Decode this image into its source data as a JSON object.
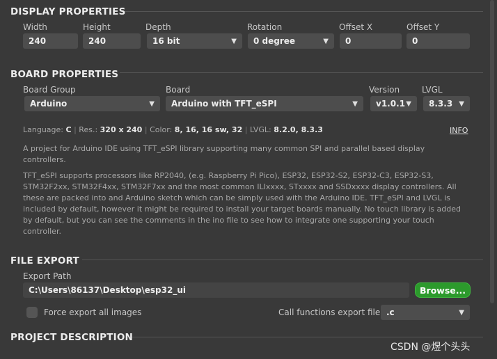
{
  "display": {
    "title": "DISPLAY PROPERTIES",
    "width_label": "Width",
    "width_value": "240",
    "height_label": "Height",
    "height_value": "240",
    "depth_label": "Depth",
    "depth_value": "16 bit",
    "rotation_label": "Rotation",
    "rotation_value": "0 degree",
    "offset_x_label": "Offset X",
    "offset_x_value": "0",
    "offset_y_label": "Offset Y",
    "offset_y_value": "0"
  },
  "board": {
    "title": "BOARD PROPERTIES",
    "group_label": "Board Group",
    "group_value": "Arduino",
    "board_label": "Board",
    "board_value": "Arduino with TFT_eSPI",
    "version_label": "Version",
    "version_value": "v1.0.1",
    "lvgl_label": "LVGL",
    "lvgl_value": "8.3.3",
    "meta": {
      "language_label": "Language:",
      "language_value": "C",
      "res_label": "Res.:",
      "res_value": "320 x 240",
      "color_label": "Color:",
      "color_value": "8, 16, 16 sw, 32",
      "lvgl_label": "LVGL:",
      "lvgl_value": "8.2.0, 8.3.3"
    },
    "info_link": "INFO",
    "description_1": "A project for Arduino IDE using TFT_eSPI library supporting many common SPI and parallel based display controllers.",
    "description_2": "TFT_eSPI supports processors like RP2040, (e.g. Raspberry Pi Pico), ESP32, ESP32-S2, ESP32-C3, ESP32-S3, STM32F2xx, STM32F4xx, STM32F7xx and the most common ILIxxxx, STxxxx and SSDxxxx display controllers. All these are packed into and Arduino sketch which can be simply used with the Arduino IDE. TFT_eSPI and LVGL is included by default, however it might be required to install your target boards manually.  No touch library is added by default, but you can see the comments in the ino file to see how to integrate one supporting your touch controller."
  },
  "export": {
    "title": "FILE EXPORT",
    "path_label": "Export Path",
    "path_value": "C:\\Users\\86137\\Desktop\\esp32_ui",
    "browse_label": "Browse...",
    "force_label": "Force export all images",
    "force_checked": false,
    "call_functions_label": "Call functions export file",
    "call_functions_value": ".c"
  },
  "project": {
    "title": "PROJECT DESCRIPTION"
  },
  "watermark": "CSDN @煜个头头",
  "colors": {
    "background": "#393939",
    "field": "#4d4d4d",
    "browse": "#2c9a2c"
  },
  "icons": {
    "dropdown": "chevron-down-icon"
  }
}
